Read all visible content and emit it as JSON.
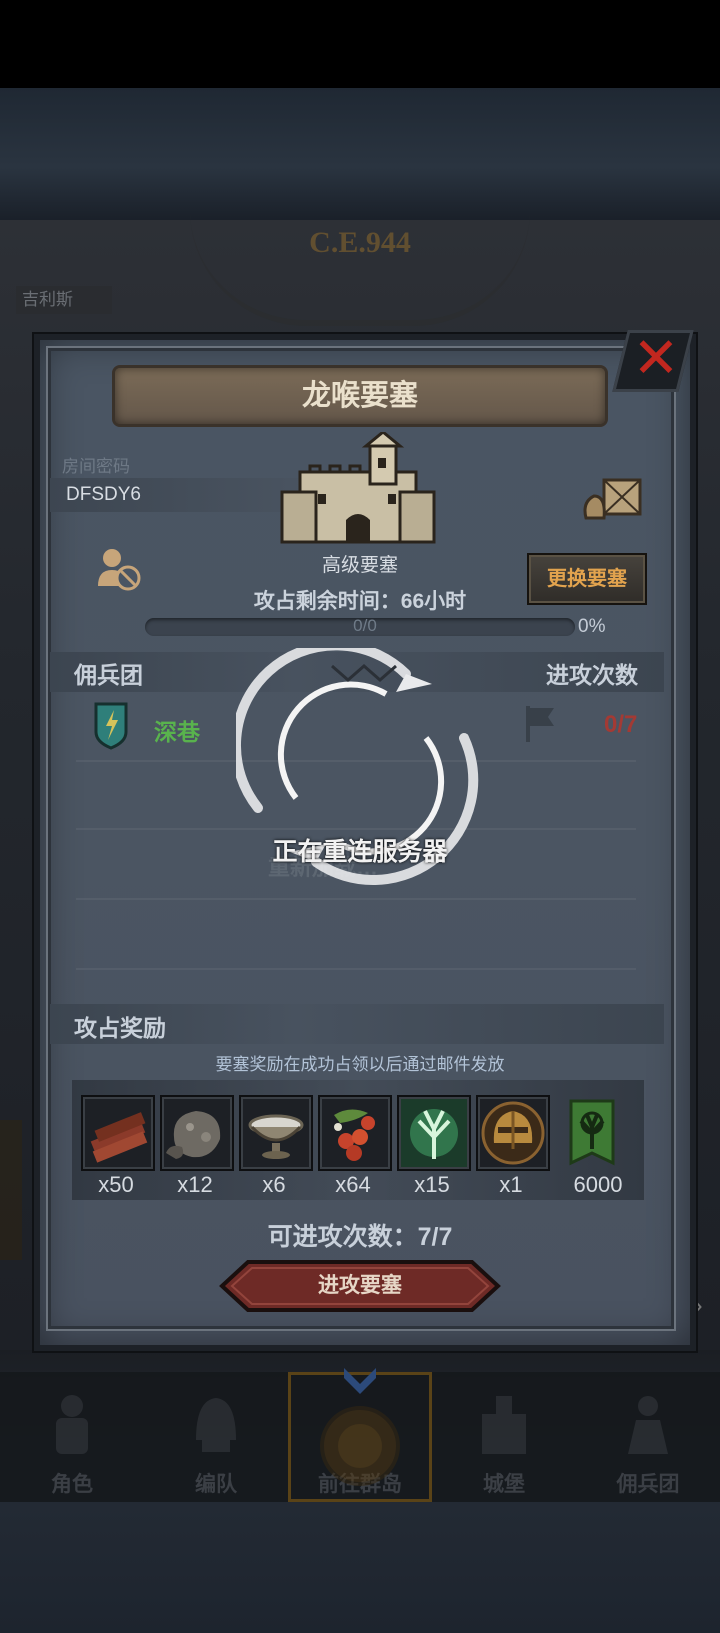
{
  "background": {
    "era": "C.E.944",
    "location": "吉利斯"
  },
  "dialog": {
    "title": "龙喉要塞",
    "room_password_label": "房间密码",
    "room_password": "DFSDY6",
    "fortress_level": "高级要塞",
    "change_button": "更换要塞",
    "remaining_time": "攻占剩余时间：66小时",
    "progress": {
      "count": "0/0",
      "percent": "0%",
      "fraction": 0
    },
    "mercenary_header": "佣兵团",
    "attack_count_header": "进攻次数",
    "mercenary": {
      "name": "深巷",
      "attacks": "0/7"
    },
    "hidden_text": "重新加载…",
    "rewards": {
      "title": "攻占奖励",
      "note": "要塞奖励在成功占领以后通过邮件发放",
      "items": [
        {
          "icon": "wood-planks-icon",
          "qty": "x50"
        },
        {
          "icon": "ore-chunk-icon",
          "qty": "x12"
        },
        {
          "icon": "silver-bowl-icon",
          "qty": "x6"
        },
        {
          "icon": "berries-icon",
          "qty": "x64"
        },
        {
          "icon": "green-spirit-icon",
          "qty": "x15"
        },
        {
          "icon": "golden-helmet-icon",
          "qty": "x1"
        },
        {
          "icon": "guild-banner-icon",
          "qty": "6000"
        }
      ]
    },
    "available_attacks": "可进攻次数：7/7",
    "attack_button": "进攻要塞"
  },
  "overlay": {
    "message": "正在重连服务器"
  },
  "navbar": {
    "items": [
      {
        "label": "角色",
        "icon": "knight-icon"
      },
      {
        "label": "编队",
        "icon": "helmet-icon"
      },
      {
        "label": "前往群岛",
        "icon": "island-compass-icon"
      },
      {
        "label": "城堡",
        "icon": "castle-icon"
      },
      {
        "label": "佣兵团",
        "icon": "mercenary-icon"
      }
    ]
  },
  "colors": {
    "accent": "#e2a34e",
    "danger": "#c2271f",
    "green": "#59b34d"
  }
}
